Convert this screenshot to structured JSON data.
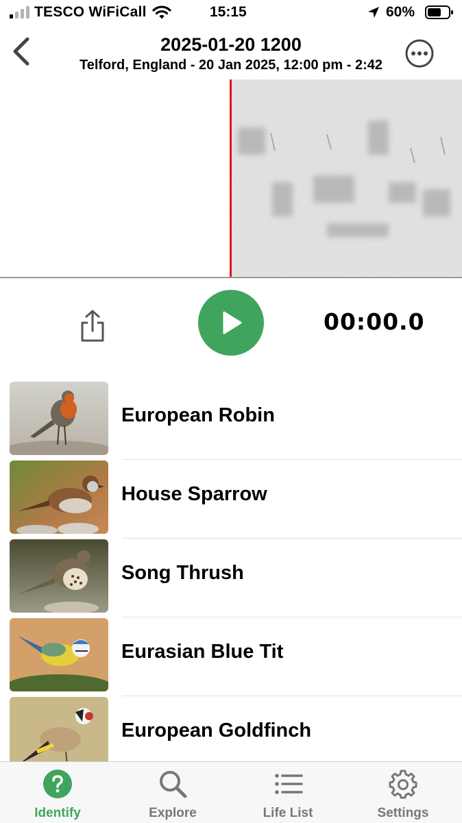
{
  "status_bar": {
    "carrier": "TESCO WiFiCall",
    "time": "15:15",
    "battery": "60%"
  },
  "header": {
    "title": "2025-01-20 1200",
    "subtitle": "Telford, England - 20 Jan 2025, 12:00 pm - 2:42"
  },
  "player": {
    "elapsed": "00:00.0"
  },
  "species": [
    {
      "name": "European Robin",
      "photo": "robin"
    },
    {
      "name": "House Sparrow",
      "photo": "sparrow"
    },
    {
      "name": "Song Thrush",
      "photo": "thrush"
    },
    {
      "name": "Eurasian Blue Tit",
      "photo": "bluetit"
    },
    {
      "name": "European Goldfinch",
      "photo": "goldfinch"
    }
  ],
  "tabs": [
    {
      "label": "Identify",
      "icon": "question-circle-icon",
      "active": true
    },
    {
      "label": "Explore",
      "icon": "magnifier-icon",
      "active": false
    },
    {
      "label": "Life List",
      "icon": "list-icon",
      "active": false
    },
    {
      "label": "Settings",
      "icon": "gear-icon",
      "active": false
    }
  ],
  "colors": {
    "accent": "#3fa55d",
    "playhead": "#e0141e",
    "inactive_tab": "#777777"
  }
}
